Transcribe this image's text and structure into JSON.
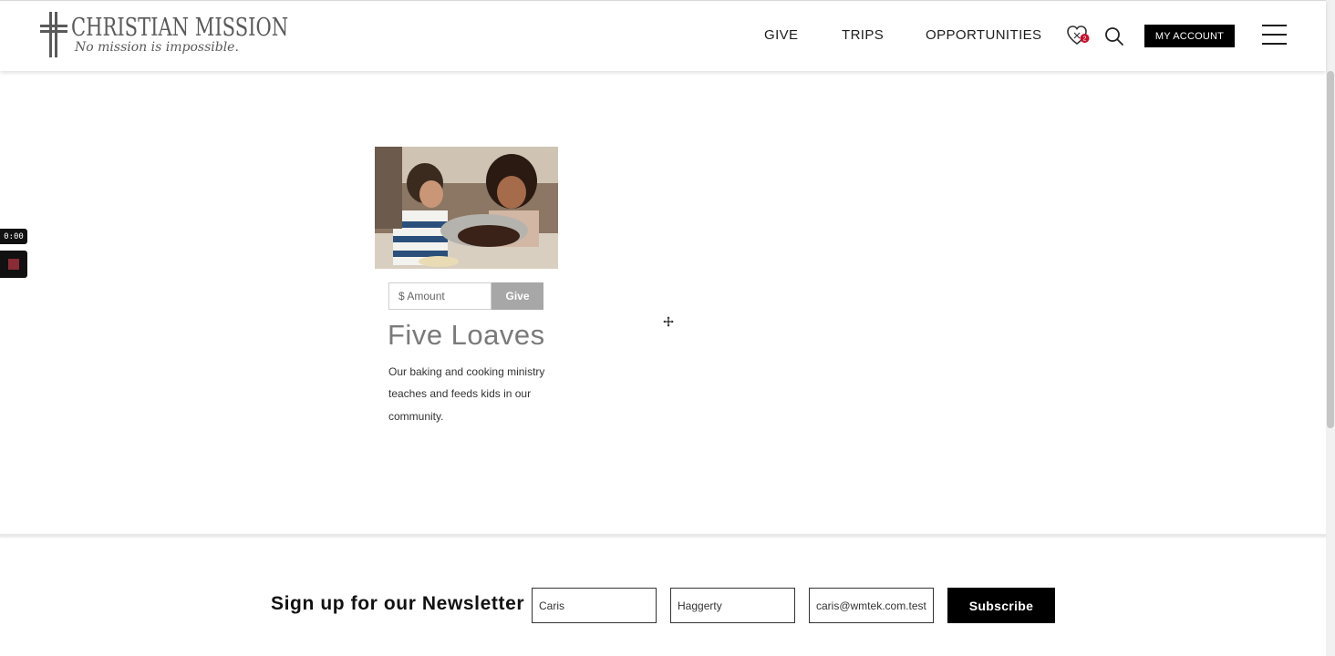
{
  "brand": {
    "name": "CHRISTIAN MISSION",
    "tagline": "No mission is impossible."
  },
  "nav": {
    "items": [
      "GIVE",
      "TRIPS",
      "OPPORTUNITIES"
    ],
    "cart_count": "2",
    "account_label": "MY ACCOUNT"
  },
  "recorder": {
    "time": "0:00"
  },
  "card": {
    "amount_placeholder": "$ Amount",
    "give_label": "Give",
    "title": "Five Loaves",
    "description": "Our baking and cooking ministry teaches and feeds kids in our community."
  },
  "newsletter": {
    "heading": "Sign up for our Newsletter",
    "first_name": "Caris",
    "last_name": "Haggerty",
    "email": "caris@wmtek.com.test",
    "subscribe_label": "Subscribe"
  },
  "colors": {
    "accent_black": "#000000",
    "give_button_gray": "#a7a7a7",
    "cart_badge": "#c8102e",
    "title_gray": "#7a7a7a"
  },
  "icons": [
    "cross-logo-icon",
    "heart-cart-icon",
    "search-icon",
    "hamburger-icon",
    "stop-icon",
    "move-cursor-icon"
  ]
}
